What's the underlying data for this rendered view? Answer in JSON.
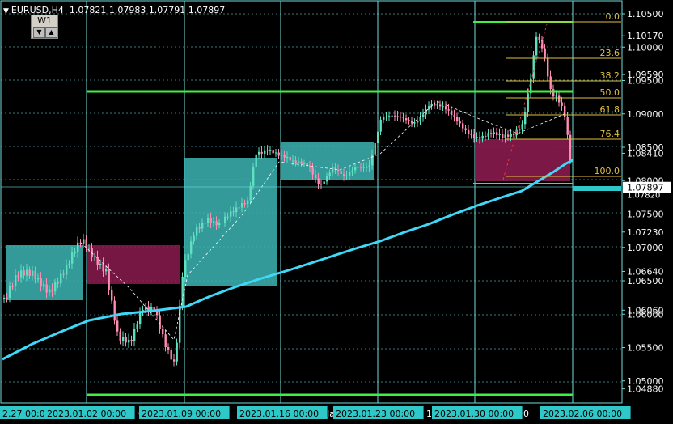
{
  "header": {
    "symbol": "EURUSD,H4",
    "ohlc": "1.07821 1.07983 1.07791 1.07897",
    "timeframe_label": "W1",
    "arrow_down": "▼",
    "arrow_up": "▲"
  },
  "price_axis": {
    "ticks": [
      "1.10500",
      "1.10170",
      "1.10000",
      "1.09590",
      "1.09500",
      "1.09000",
      "1.08500",
      "1.08410",
      "1.08000",
      "1.07500",
      "1.07230",
      "1.07000",
      "1.06640",
      "1.06500",
      "1.06060",
      "1.06000",
      "1.05500",
      "1.05000",
      "1.04880"
    ],
    "current_price": "1.07897",
    "current_price_overlay": "1.07820"
  },
  "time_axis": {
    "labels": [
      "2.27 00:0",
      "2023.01.02 00:00",
      "0",
      "2023.01.09 00:00",
      "2023.01.16 00:00",
      "Ja",
      "2023.01.23 00:00",
      "16",
      "2023.01.30 00:00",
      "0",
      "2023.02.06 00:00"
    ]
  },
  "fibonacci": {
    "levels": [
      "0.0",
      "23.6",
      "38.2",
      "50.0",
      "61.8",
      "76.4",
      "100.0"
    ],
    "color": "#e0c040"
  },
  "colors": {
    "background": "#000000",
    "grid": "#6fdcdc",
    "bull_candle": "#5fe0c0",
    "bear_candle": "#ff8cb4",
    "moving_average": "#40d8f8",
    "trend_lines": "#40f040",
    "box_cyan": "#3cb4b4",
    "box_maroon": "#8a1b4e",
    "price_tag": "#2fc8c8"
  }
}
